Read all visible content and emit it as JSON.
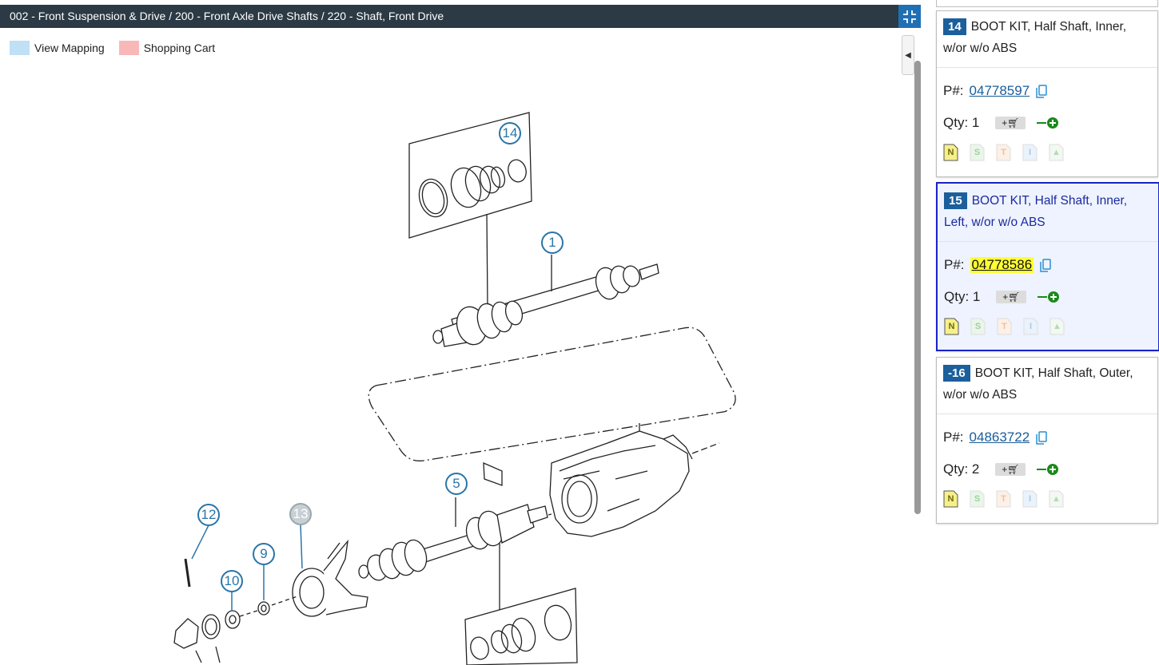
{
  "header": {
    "breadcrumb": "002 - Front Suspension & Drive / 200 - Front Axle Drive Shafts / 220 - Shaft, Front Drive"
  },
  "legend": [
    {
      "label": "View Mapping",
      "color": "#bfe0f5"
    },
    {
      "label": "Shopping Cart",
      "color": "#f8b8b8"
    }
  ],
  "callouts": [
    {
      "num": "14",
      "active": true
    },
    {
      "num": "1",
      "active": true
    },
    {
      "num": "5",
      "active": true
    },
    {
      "num": "12",
      "active": true
    },
    {
      "num": "13",
      "active": false
    },
    {
      "num": "9",
      "active": true
    },
    {
      "num": "10",
      "active": true
    }
  ],
  "parts": [
    {
      "badge": "14",
      "desc": "BOOT KIT, Half Shaft, Inner, w/or w/o ABS",
      "pn_label": "P#:",
      "pn": "04778597",
      "qty_label": "Qty:",
      "qty": "1",
      "selected": false
    },
    {
      "badge": "15",
      "desc": "BOOT KIT, Half Shaft, Inner, Left, w/or w/o ABS",
      "pn_label": "P#:",
      "pn": "04778586",
      "qty_label": "Qty:",
      "qty": "1",
      "selected": true
    },
    {
      "badge": "-16",
      "desc": "BOOT KIT, Half Shaft, Outer, w/or w/o ABS",
      "pn_label": "P#:",
      "pn": "04863722",
      "qty_label": "Qty:",
      "qty": "2",
      "selected": false
    }
  ],
  "doc_icons": [
    {
      "letter": "N",
      "color": "#6b6b10",
      "bg": "#f7f08a",
      "active": true
    },
    {
      "letter": "S",
      "color": "#9fd09f",
      "bg": "#eaf6ea",
      "active": false
    },
    {
      "letter": "T",
      "color": "#f0c0a0",
      "bg": "#fdf0e6",
      "active": false
    },
    {
      "letter": "I",
      "color": "#a8c8e8",
      "bg": "#eaf2fb",
      "active": false
    },
    {
      "letter": "",
      "color": "#b8d8b8",
      "bg": "#f2f8f2",
      "active": false
    }
  ],
  "colors": {
    "header_bg": "#2b3a44",
    "accent": "#1f6fb5",
    "callout": "#2a75a8",
    "callout_inactive": "#9aa6ae"
  }
}
